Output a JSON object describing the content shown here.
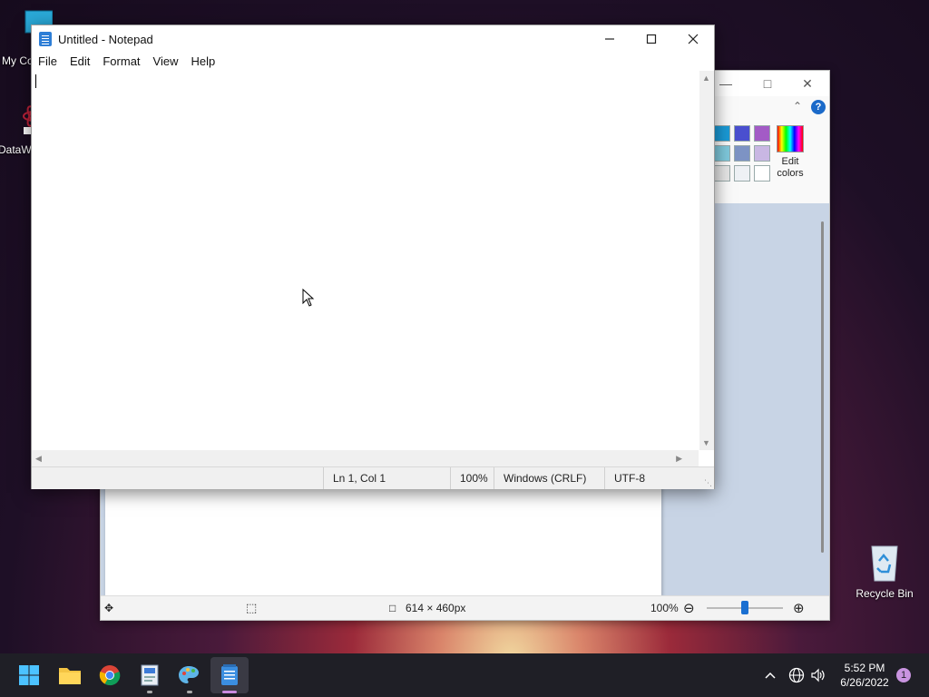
{
  "desktop": {
    "icons": [
      {
        "label": "My Co"
      },
      {
        "label": "DataW"
      },
      {
        "label": "Recycle Bin"
      }
    ]
  },
  "paint": {
    "edit_colors_line1": "Edit",
    "edit_colors_line2": "colors",
    "help_glyph": "?",
    "status": {
      "dimensions": "614 × 460px",
      "zoom": "100%"
    },
    "palette_colors": [
      "#1a9ad6",
      "#4a4fcf",
      "#a35bc6",
      "#7fc9dc",
      "#7d93c4",
      "#c9b7e3",
      "#e6e6e6",
      "#eef1f5",
      "#ffffff"
    ]
  },
  "notepad": {
    "title": "Untitled - Notepad",
    "menu": [
      "File",
      "Edit",
      "Format",
      "View",
      "Help"
    ],
    "status": {
      "position": "Ln 1, Col 1",
      "zoom": "100%",
      "line_ending": "Windows (CRLF)",
      "encoding": "UTF-8"
    }
  },
  "taskbar": {
    "time": "5:52 PM",
    "date": "6/26/2022",
    "notification_count": "1"
  }
}
